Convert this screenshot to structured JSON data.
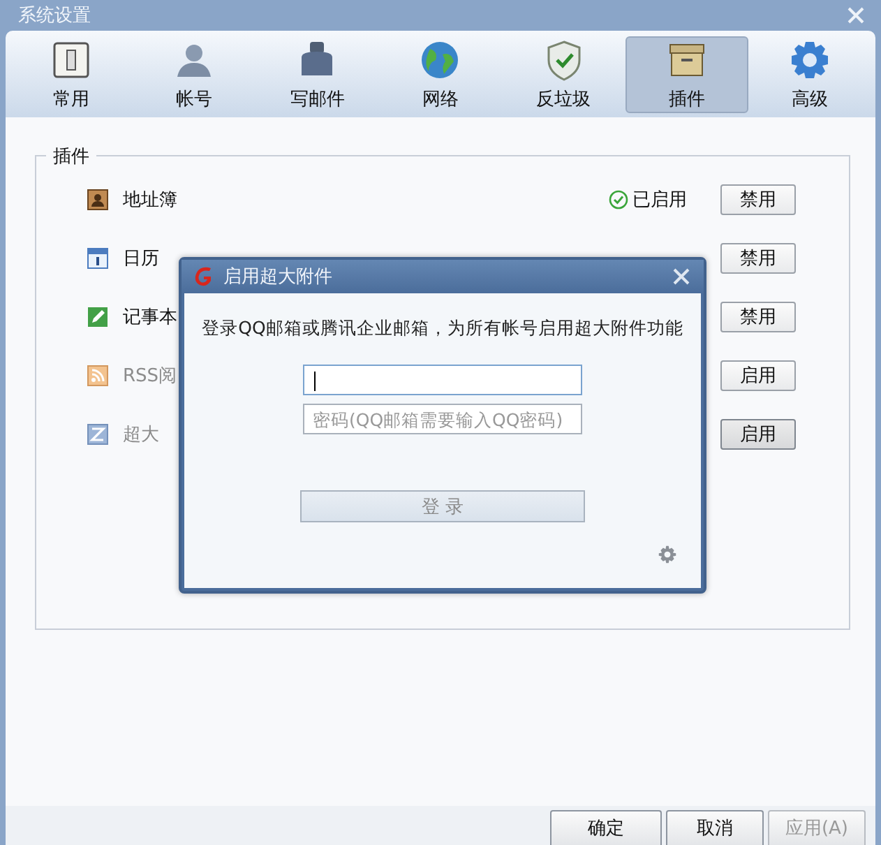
{
  "window": {
    "title": "系统设置"
  },
  "tabs": [
    {
      "label": "常用",
      "selected": false
    },
    {
      "label": "帐号",
      "selected": false
    },
    {
      "label": "写邮件",
      "selected": false
    },
    {
      "label": "网络",
      "selected": false
    },
    {
      "label": "反垃圾",
      "selected": false
    },
    {
      "label": "插件",
      "selected": true
    },
    {
      "label": "高级",
      "selected": false
    }
  ],
  "plugins": {
    "title": "插件",
    "items": [
      {
        "name": "地址簿",
        "enabled": true,
        "status": "已启用",
        "button": "禁用",
        "hovered": false
      },
      {
        "name": "日历",
        "enabled": true,
        "button": "禁用",
        "hovered": false
      },
      {
        "name": "记事本",
        "enabled": true,
        "button": "禁用",
        "hovered": false
      },
      {
        "name": "RSS阅",
        "enabled": false,
        "button": "启用",
        "hovered": false
      },
      {
        "name": "超大",
        "enabled": false,
        "button": "启用",
        "hovered": true
      }
    ]
  },
  "dialog": {
    "title": "启用超大附件",
    "message": "登录QQ邮箱或腾讯企业邮箱，为所有帐号启用超大附件功能",
    "account_field": {
      "focused": true
    },
    "password_field": {
      "placeholder": "密码(QQ邮箱需要输入QQ密码)",
      "focused": false
    },
    "login_button": {
      "label": "登 录",
      "disabled": true
    }
  },
  "buttons": [
    {
      "label": "确定",
      "disabled": false
    },
    {
      "label": "取消",
      "disabled": false
    },
    {
      "label": "应用(A)",
      "disabled": true
    }
  ]
}
